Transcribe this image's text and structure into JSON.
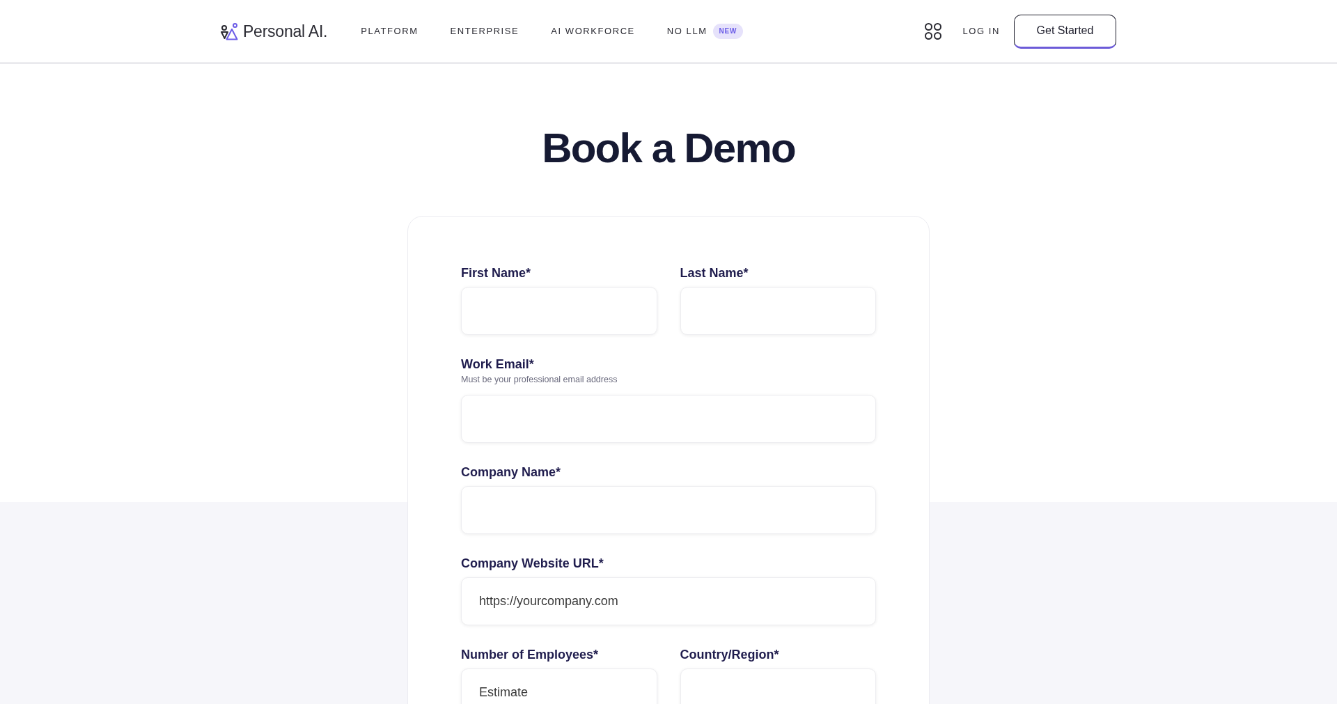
{
  "header": {
    "logo": "Personal AI.",
    "nav": [
      {
        "label": "PLATFORM"
      },
      {
        "label": "ENTERPRISE"
      },
      {
        "label": "AI WORKFORCE"
      },
      {
        "label": "NO LLM",
        "badge": "NEW"
      }
    ],
    "login": "LOG IN",
    "cta": "Get Started"
  },
  "title": "Book a Demo",
  "form": {
    "rows": [
      {
        "fields": [
          {
            "label": "First Name*"
          },
          {
            "label": "Last Name*"
          }
        ]
      },
      {
        "fields": [
          {
            "label": "Work Email*",
            "hint": "Must be your professional email address"
          }
        ]
      },
      {
        "fields": [
          {
            "label": "Company Name*"
          }
        ]
      },
      {
        "fields": [
          {
            "label": "Company Website URL*",
            "placeholder": "https://yourcompany.com"
          }
        ]
      },
      {
        "fields": [
          {
            "label": "Number of Employees*",
            "placeholder": "Estimate"
          },
          {
            "label": "Country/Region*"
          }
        ]
      }
    ]
  }
}
